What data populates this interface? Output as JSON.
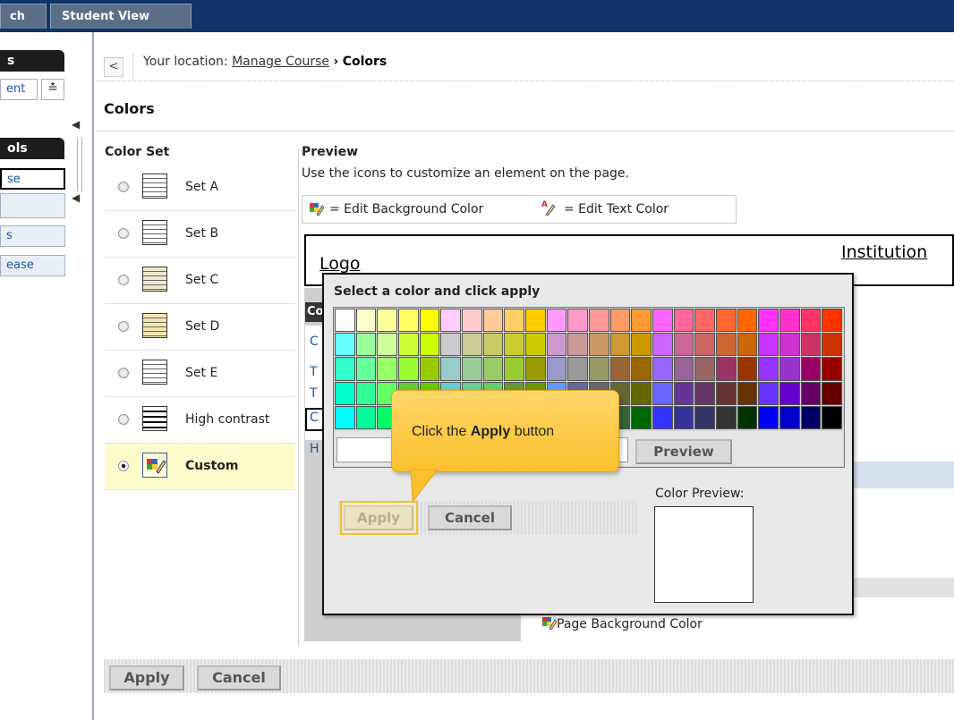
{
  "topbar": {
    "tabs": [
      {
        "label": "ch"
      },
      {
        "label": "Student View"
      }
    ]
  },
  "leftpanel": {
    "section1_header": "s",
    "section1_item": "ent",
    "collapse_glyph": "«",
    "section2_header": "ols",
    "section2_items": [
      "se",
      "",
      "s",
      "ease"
    ]
  },
  "breadcrumb": {
    "back_glyph": "<",
    "prefix": "Your location:",
    "link": "Manage Course",
    "separator": "›",
    "current": "Colors"
  },
  "page": {
    "title": "Colors",
    "colorset_heading": "Color Set",
    "preview_heading": "Preview",
    "preview_instructions": "Use the icons to customize an element on the page."
  },
  "color_sets": [
    {
      "label": "Set A",
      "selected": false
    },
    {
      "label": "Set B",
      "selected": false
    },
    {
      "label": "Set C",
      "selected": false
    },
    {
      "label": "Set D",
      "selected": false
    },
    {
      "label": "Set E",
      "selected": false
    },
    {
      "label": "High contrast",
      "selected": false
    },
    {
      "label": "Custom",
      "selected": true
    }
  ],
  "legend": {
    "edit_bg": "= Edit Background Color",
    "edit_text": "= Edit Text Color"
  },
  "preview": {
    "logo": "Logo",
    "institution": "Institution",
    "left_letters": [
      "Co",
      "C",
      "T",
      "T",
      "C",
      "H"
    ],
    "page_bg_label": "Page Background Color"
  },
  "dialog": {
    "title": "Select a color and click apply",
    "preview_button": "Preview",
    "apply_button": "Apply",
    "cancel_button": "Cancel",
    "color_preview_label": "Color Preview:"
  },
  "callout": {
    "text_before": "Click the ",
    "text_bold": "Apply",
    "text_after": " button"
  },
  "footer": {
    "apply_button": "Apply",
    "cancel_button": "Cancel"
  },
  "colors": {
    "topbar": "#0f3466",
    "callout": "#fbc02d",
    "custom_highlight": "#fdfbcc"
  },
  "palette": [
    [
      "#ffffff",
      "#ffffcc",
      "#ffff99",
      "#ffff66",
      "#ffff00",
      "#ffccff",
      "#ffcccc",
      "#ffcc99",
      "#ffcc66",
      "#ffcc00",
      "#ff99ff",
      "#ff99cc",
      "#ff9999",
      "#ff9966",
      "#ff9933",
      "#ff66ff",
      "#ff6699",
      "#ff6666",
      "#ff6633",
      "#ff6600",
      "#ff33ff",
      "#ff33cc",
      "#ff3366",
      "#ff3300"
    ],
    [
      "#66ffff",
      "#99ff99",
      "#ccff99",
      "#ccff33",
      "#ccff00",
      "#cccccc",
      "#cccc99",
      "#cccc66",
      "#cccc33",
      "#cccc00",
      "#cc99cc",
      "#cc9999",
      "#cc9966",
      "#cc9933",
      "#cc9900",
      "#cc66ff",
      "#cc6699",
      "#cc6666",
      "#cc6633",
      "#cc6600",
      "#cc33ff",
      "#cc33cc",
      "#cc3366",
      "#cc3300"
    ],
    [
      "#33ffcc",
      "#66ff99",
      "#99ff66",
      "#99ff33",
      "#99cc00",
      "#99cccc",
      "#99cc99",
      "#99cc66",
      "#99cc33",
      "#999900",
      "#9999cc",
      "#999999",
      "#999966",
      "#996633",
      "#996600",
      "#9966ff",
      "#996699",
      "#996666",
      "#993366",
      "#993300",
      "#9933ff",
      "#9933cc",
      "#990066",
      "#990000"
    ],
    [
      "#00ffcc",
      "#33ff99",
      "#66ff66",
      "#66cc33",
      "#66cc00",
      "#66cccc",
      "#66cc99",
      "#66cc66",
      "#669933",
      "#669900",
      "#6699ff",
      "#666699",
      "#666666",
      "#666633",
      "#666600",
      "#6666ff",
      "#663399",
      "#663366",
      "#663333",
      "#663300",
      "#6633ff",
      "#6600cc",
      "#660066",
      "#660000"
    ],
    [
      "#00ffff",
      "#00ff99",
      "#00ff66",
      "#33cc33",
      "#33cc00",
      "#33cccc",
      "#339999",
      "#339966",
      "#339933",
      "#009900",
      "#3399ff",
      "#336699",
      "#336666",
      "#336633",
      "#006600",
      "#3333ff",
      "#333399",
      "#333366",
      "#333333",
      "#003300",
      "#0000ff",
      "#0000cc",
      "#000066",
      "#000000"
    ]
  ]
}
